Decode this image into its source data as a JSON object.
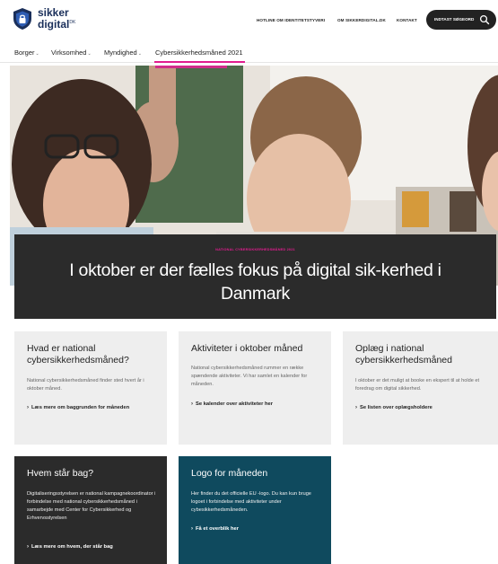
{
  "header": {
    "logo": {
      "name": "sikker",
      "name2": "digital",
      "suffix": "DK"
    },
    "topnav": [
      "HOTLINE OM IDENTITETSTYVERI",
      "OM SIKKERDIGITAL.DK",
      "KONTAKT"
    ],
    "search_label": "INDTAST SØGEORD"
  },
  "mainnav": [
    "Borger",
    "Virksomhed",
    "Myndighed",
    "Cybersikkerhedsmåned 2021"
  ],
  "hero": {
    "eyebrow": "NATIONAL CYBERSIKKERHEDSMÅNED 2021",
    "title": "I oktober er der fælles fokus på digital sik-kerhed i Danmark"
  },
  "cards": [
    {
      "title": "Hvad er national cybersikkerhedsmåned?",
      "text": "National cybersikkerhedsmåned finder sted hvert år i oktober måned.",
      "link": "Læs mere om baggrunden for måneden"
    },
    {
      "title": "Aktiviteter i oktober måned",
      "text": "National cybersikkerhedsmåned rummer en række spændende aktiviteter. Vi har samlet en kalender for måneden.",
      "link": "Se kalender over aktiviteter her"
    },
    {
      "title": "Oplæg i national cybersikkerhedsmåned",
      "text": "I oktober er det muligt at booke en ekspert til at holde et foredrag om digital sikkerhed.",
      "link": "Se listen over oplægsholdere"
    },
    {
      "title": "Hvem står bag?",
      "text": "Digitaliseringsstyrelsen er national kampagnekoordinator i forbindelse med national cybersikkerhedsmåned i samarbejde med Center for Cybersikkerhed og Erhvervsstyrelsen",
      "link": "Læs mere om hvem, der står bag"
    },
    {
      "title": "Logo for måneden",
      "text": "Her finder du det officielle EU -logo. Du kan kun bruge logoet i forbindelse med aktiviteter under cybesikkerhedsmåneden.",
      "link": "Få et overblik her"
    }
  ],
  "colors": {
    "accent": "#e11c8f",
    "dark": "#2b2b2b",
    "teal": "#0f4a5e",
    "grey_card": "#eeeeee",
    "brand_blue": "#1a2f5a"
  },
  "icons": [
    "shield-logo-icon",
    "search-icon",
    "chevron-down-icon",
    "arrow-right-icon"
  ]
}
